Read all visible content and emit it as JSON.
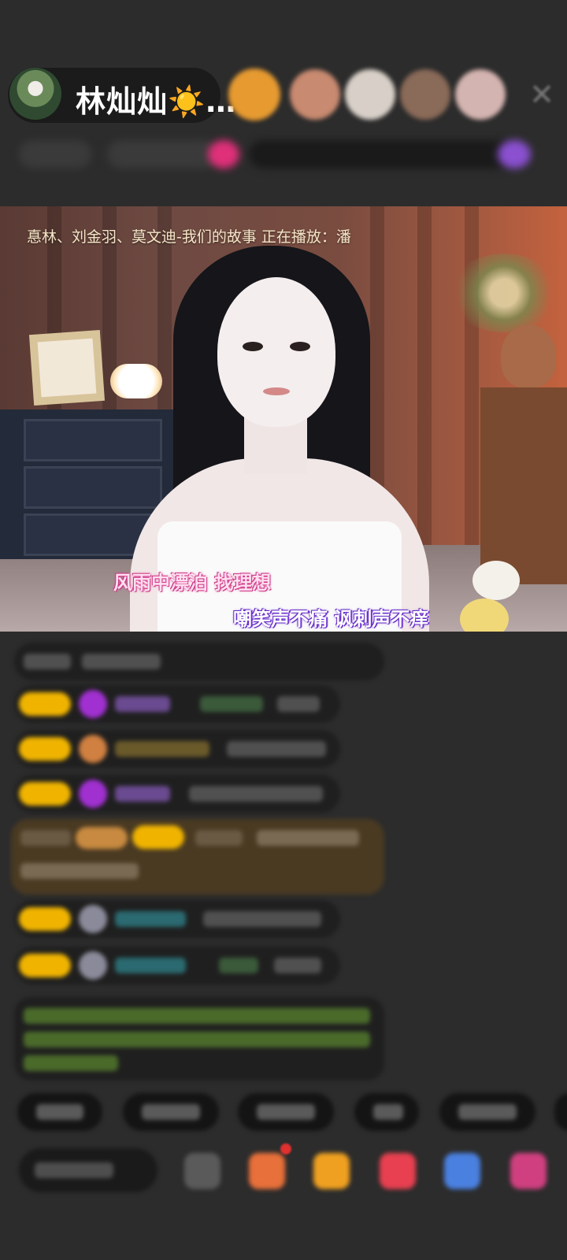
{
  "header": {
    "host_name": "林灿灿☀️…",
    "viewer_avatars": [
      "viewer-avatar-1",
      "viewer-avatar-2",
      "viewer-avatar-3",
      "viewer-avatar-4",
      "viewer-avatar-5"
    ],
    "close_icon": "close-icon"
  },
  "video": {
    "now_playing_ticker": "惪林、刘金羽、莫文迪-我们的故事  正在播放：潘",
    "lyric_line_1": "风雨中漂泊  找理想",
    "lyric_line_2": "嘲笑声不痛  讽刺声不痒"
  },
  "colors": {
    "background": "#2c2c2c",
    "badge_gold": "#f0b400",
    "lyric_pink": "#e04090",
    "lyric_purple": "#7040d0"
  }
}
